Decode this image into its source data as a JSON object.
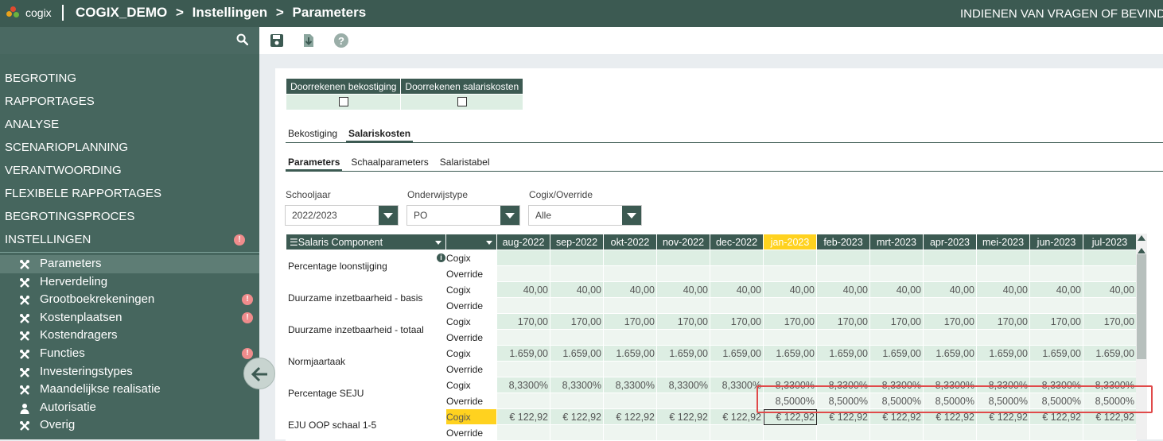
{
  "header": {
    "logo_text": "cogix",
    "breadcrumb": [
      "COGIX_DEMO",
      ">",
      "Instellingen",
      ">",
      "Parameters"
    ],
    "right_text": "INDIENEN VAN VRAGEN OF BEVIND"
  },
  "sidebar": {
    "menu": [
      "BEGROTING",
      "RAPPORTAGES",
      "ANALYSE",
      "SCENARIOPLANNING",
      "VERANTWOORDING",
      "FLEXIBELE RAPPORTAGES",
      "BEGROTINGSPROCES",
      "INSTELLINGEN"
    ],
    "alert_glyph": "!",
    "sub_items": [
      "Parameters",
      "Herverdeling",
      "Grootboekrekeningen",
      "Kostenplaatsen",
      "Kostendragers",
      "Functies",
      "Investeringstypes",
      "Maandelijkse realisatie",
      "Autorisatie",
      "Overig"
    ],
    "sub_alerts": [
      false,
      false,
      true,
      true,
      false,
      true,
      false,
      false,
      false,
      false
    ],
    "active_item": "Parameters"
  },
  "toolbar": {
    "icons": [
      "save-icon",
      "download-icon",
      "help-icon"
    ]
  },
  "recalc": {
    "headers": [
      "Doorrekenen bekostiging",
      "Doorrekenen salariskosten"
    ],
    "checked": [
      false,
      false
    ]
  },
  "tabs": [
    "Bekostiging",
    "Salariskosten"
  ],
  "active_tab": "Salariskosten",
  "subtabs": [
    "Parameters",
    "Schaalparameters",
    "Salaristabel"
  ],
  "active_subtab": "Parameters",
  "filters": [
    {
      "label": "Schooljaar",
      "value": "2022/2023"
    },
    {
      "label": "Onderwijstype",
      "value": "PO"
    },
    {
      "label": "Cogix/Override",
      "value": "Alle"
    }
  ],
  "grid": {
    "component_header": "Salaris Component",
    "months": [
      "aug-2022",
      "sep-2022",
      "okt-2022",
      "nov-2022",
      "dec-2022",
      "jan-2023",
      "feb-2023",
      "mrt-2023",
      "apr-2023",
      "mei-2023",
      "jun-2023",
      "jul-2023"
    ],
    "highlight_month": "jan-2023",
    "source_labels": [
      "Cogix",
      "Override"
    ],
    "rows": [
      {
        "label": "Percentage loonstijging",
        "info": "i",
        "cogix": [
          "",
          "",
          "",
          "",
          "",
          "",
          "",
          "",
          "",
          "",
          "",
          ""
        ],
        "override": [
          "",
          "",
          "",
          "",
          "",
          "",
          "",
          "",
          "",
          "",
          "",
          ""
        ]
      },
      {
        "label": "Duurzame inzetbaarheid - basis",
        "cogix": [
          "40,00",
          "40,00",
          "40,00",
          "40,00",
          "40,00",
          "40,00",
          "40,00",
          "40,00",
          "40,00",
          "40,00",
          "40,00",
          "40,00"
        ],
        "override": [
          "",
          "",
          "",
          "",
          "",
          "",
          "",
          "",
          "",
          "",
          "",
          ""
        ]
      },
      {
        "label": "Duurzame inzetbaarheid - totaal",
        "cogix": [
          "170,00",
          "170,00",
          "170,00",
          "170,00",
          "170,00",
          "170,00",
          "170,00",
          "170,00",
          "170,00",
          "170,00",
          "170,00",
          "170,00"
        ],
        "override": [
          "",
          "",
          "",
          "",
          "",
          "",
          "",
          "",
          "",
          "",
          "",
          ""
        ]
      },
      {
        "label": "Normjaartaak",
        "cogix": [
          "1.659,00",
          "1.659,00",
          "1.659,00",
          "1.659,00",
          "1.659,00",
          "1.659,00",
          "1.659,00",
          "1.659,00",
          "1.659,00",
          "1.659,00",
          "1.659,00",
          "1.659,00"
        ],
        "override": [
          "",
          "",
          "",
          "",
          "",
          "",
          "",
          "",
          "",
          "",
          "",
          ""
        ]
      },
      {
        "label": "Percentage SEJU",
        "cogix": [
          "8,3300%",
          "8,3300%",
          "8,3300%",
          "8,3300%",
          "8,3300%",
          "8,3300%",
          "8,3300%",
          "8,3300%",
          "8,3300%",
          "8,3300%",
          "8,3300%",
          "8,3300%"
        ],
        "override": [
          "",
          "",
          "",
          "",
          "",
          "8,5000%",
          "8,5000%",
          "8,5000%",
          "8,5000%",
          "8,5000%",
          "8,5000%",
          "8,5000%"
        ]
      },
      {
        "label": "EJU OOP schaal 1-5",
        "cogix_highlight": true,
        "cogix": [
          "€ 122,92",
          "€ 122,92",
          "€ 122,92",
          "€ 122,92",
          "€ 122,92",
          "€ 122,92",
          "€ 122,92",
          "€ 122,92",
          "€ 122,92",
          "€ 122,92",
          "€ 122,92",
          "€ 122,92"
        ],
        "override": [
          "",
          "",
          "",
          "",
          "",
          "",
          "",
          "",
          "",
          "",
          "",
          ""
        ]
      }
    ]
  },
  "colors": {
    "primary": "#3c5a52",
    "sidebar": "#46665e",
    "cell": "#ddeee3",
    "highlight": "#ffd21f",
    "alert": "#f08c8c",
    "annotation": "#e04a4a"
  }
}
